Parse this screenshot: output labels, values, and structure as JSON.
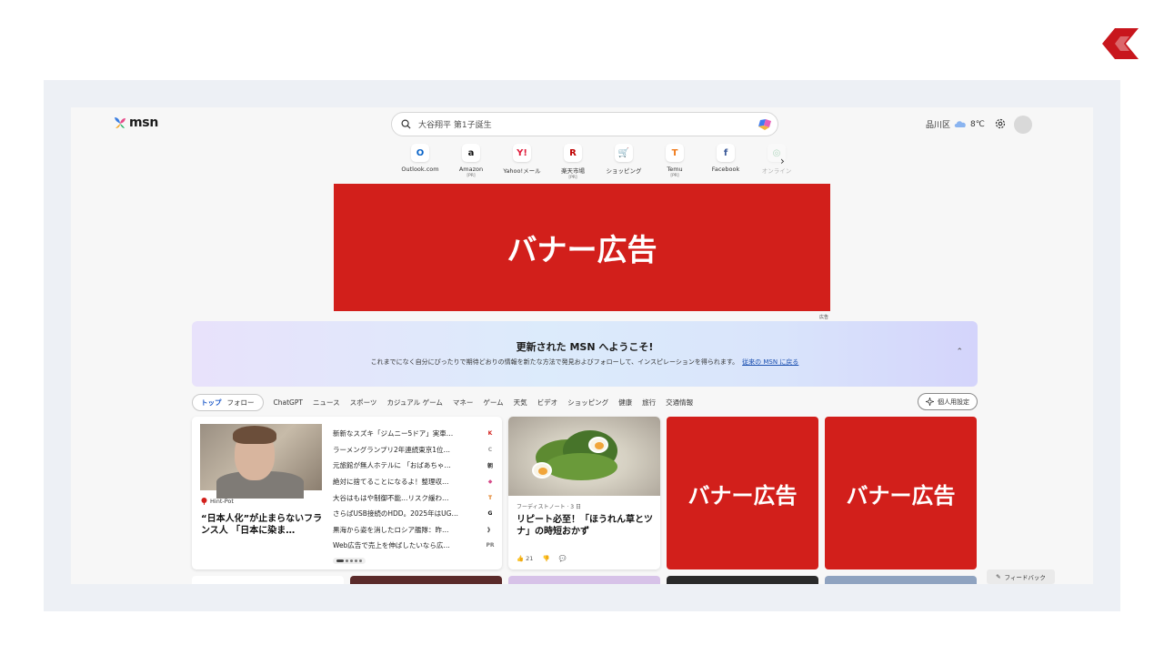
{
  "brand": {
    "logo_text": "msn"
  },
  "search": {
    "query": "大谷翔平 第1子誕生"
  },
  "weather": {
    "location": "品川区",
    "temp": "8℃"
  },
  "quick_links": [
    {
      "label": "Outlook.com",
      "icon": "outlook-icon",
      "glyph": "O",
      "color": "#0a64c8",
      "pr": ""
    },
    {
      "label": "Amazon",
      "icon": "amazon-icon",
      "glyph": "a",
      "color": "#111111",
      "pr": "[PR]"
    },
    {
      "label": "Yahoo!メール",
      "icon": "yahoo-mail-icon",
      "glyph": "Y!",
      "color": "#e01e3c",
      "pr": ""
    },
    {
      "label": "楽天市場",
      "icon": "rakuten-icon",
      "glyph": "R",
      "color": "#bf0000",
      "pr": "[PR]"
    },
    {
      "label": "ショッピング",
      "icon": "shopping-cart-icon",
      "glyph": "🛒",
      "color": "#0a64c8",
      "pr": ""
    },
    {
      "label": "Temu",
      "icon": "temu-icon",
      "glyph": "T",
      "color": "#f07a1a",
      "pr": "[PR]"
    },
    {
      "label": "Facebook",
      "icon": "facebook-icon",
      "glyph": "f",
      "color": "#3b5998",
      "pr": ""
    },
    {
      "label": "オンライン",
      "icon": "online-game-icon",
      "glyph": "◎",
      "color": "#2b9a55",
      "pr": ""
    }
  ],
  "top_banner": {
    "text": "バナー広告",
    "ad_label": "広告"
  },
  "welcome": {
    "title": "更新された MSN へようこそ!",
    "body": "これまでになく自分にぴったりで期待どおりの情報を新たな方法で発見およびフォローして、インスピレーションを得られます。",
    "link": "従来の MSN に戻る"
  },
  "tabs": {
    "pill": [
      "トップ",
      "フォロー"
    ],
    "items": [
      "ChatGPT",
      "ニュース",
      "スポーツ",
      "カジュアル ゲーム",
      "マネー",
      "ゲーム",
      "天気",
      "ビデオ",
      "ショッピング",
      "健康",
      "旅行",
      "交通情報"
    ],
    "personalize": "個人用設定"
  },
  "feature": {
    "source": "Hint-Pot",
    "title": "“日本人化”が止まらないフランス人 「日本に染ま…",
    "list": [
      {
        "text": "新新なスズキ「ジムニー5ドア」実車…",
        "src": "K",
        "color": "#d21f1b"
      },
      {
        "text": "ラーメングランプリ2年連続東京1位…",
        "src": "C",
        "color": "#9a9a9a"
      },
      {
        "text": "元旅館が無人ホテルに 「おばあちゃ…",
        "src": "朝",
        "color": "#333333"
      },
      {
        "text": "絶対に捨てることになるよ！整理収…",
        "src": "◆",
        "color": "#d64c8a"
      },
      {
        "text": "大谷はもはや制御不能…リスク緩わ…",
        "src": "T",
        "color": "#e07a1a"
      },
      {
        "text": "さらばUSB接続のHDD。2025年はUG…",
        "src": "G",
        "color": "#111111"
      },
      {
        "text": "黒海から姿を消したロシア艦隊：昨…",
        "src": "》",
        "color": "#333333"
      },
      {
        "text": "Web広告で売上を伸ばしたいなら広…",
        "src": "PR",
        "color": "#777777"
      }
    ]
  },
  "recipe": {
    "source": "フーディストノート · 3 日",
    "title": "リピート必至！「ほうれん草とツナ」の時短おかず",
    "likes": "21"
  },
  "ad_cards": [
    "バナー広告",
    "バナー広告"
  ],
  "feedback": "フィードバック",
  "colors": {
    "ad_red": "#d21f1b",
    "accent_blue": "#1a57c8"
  }
}
